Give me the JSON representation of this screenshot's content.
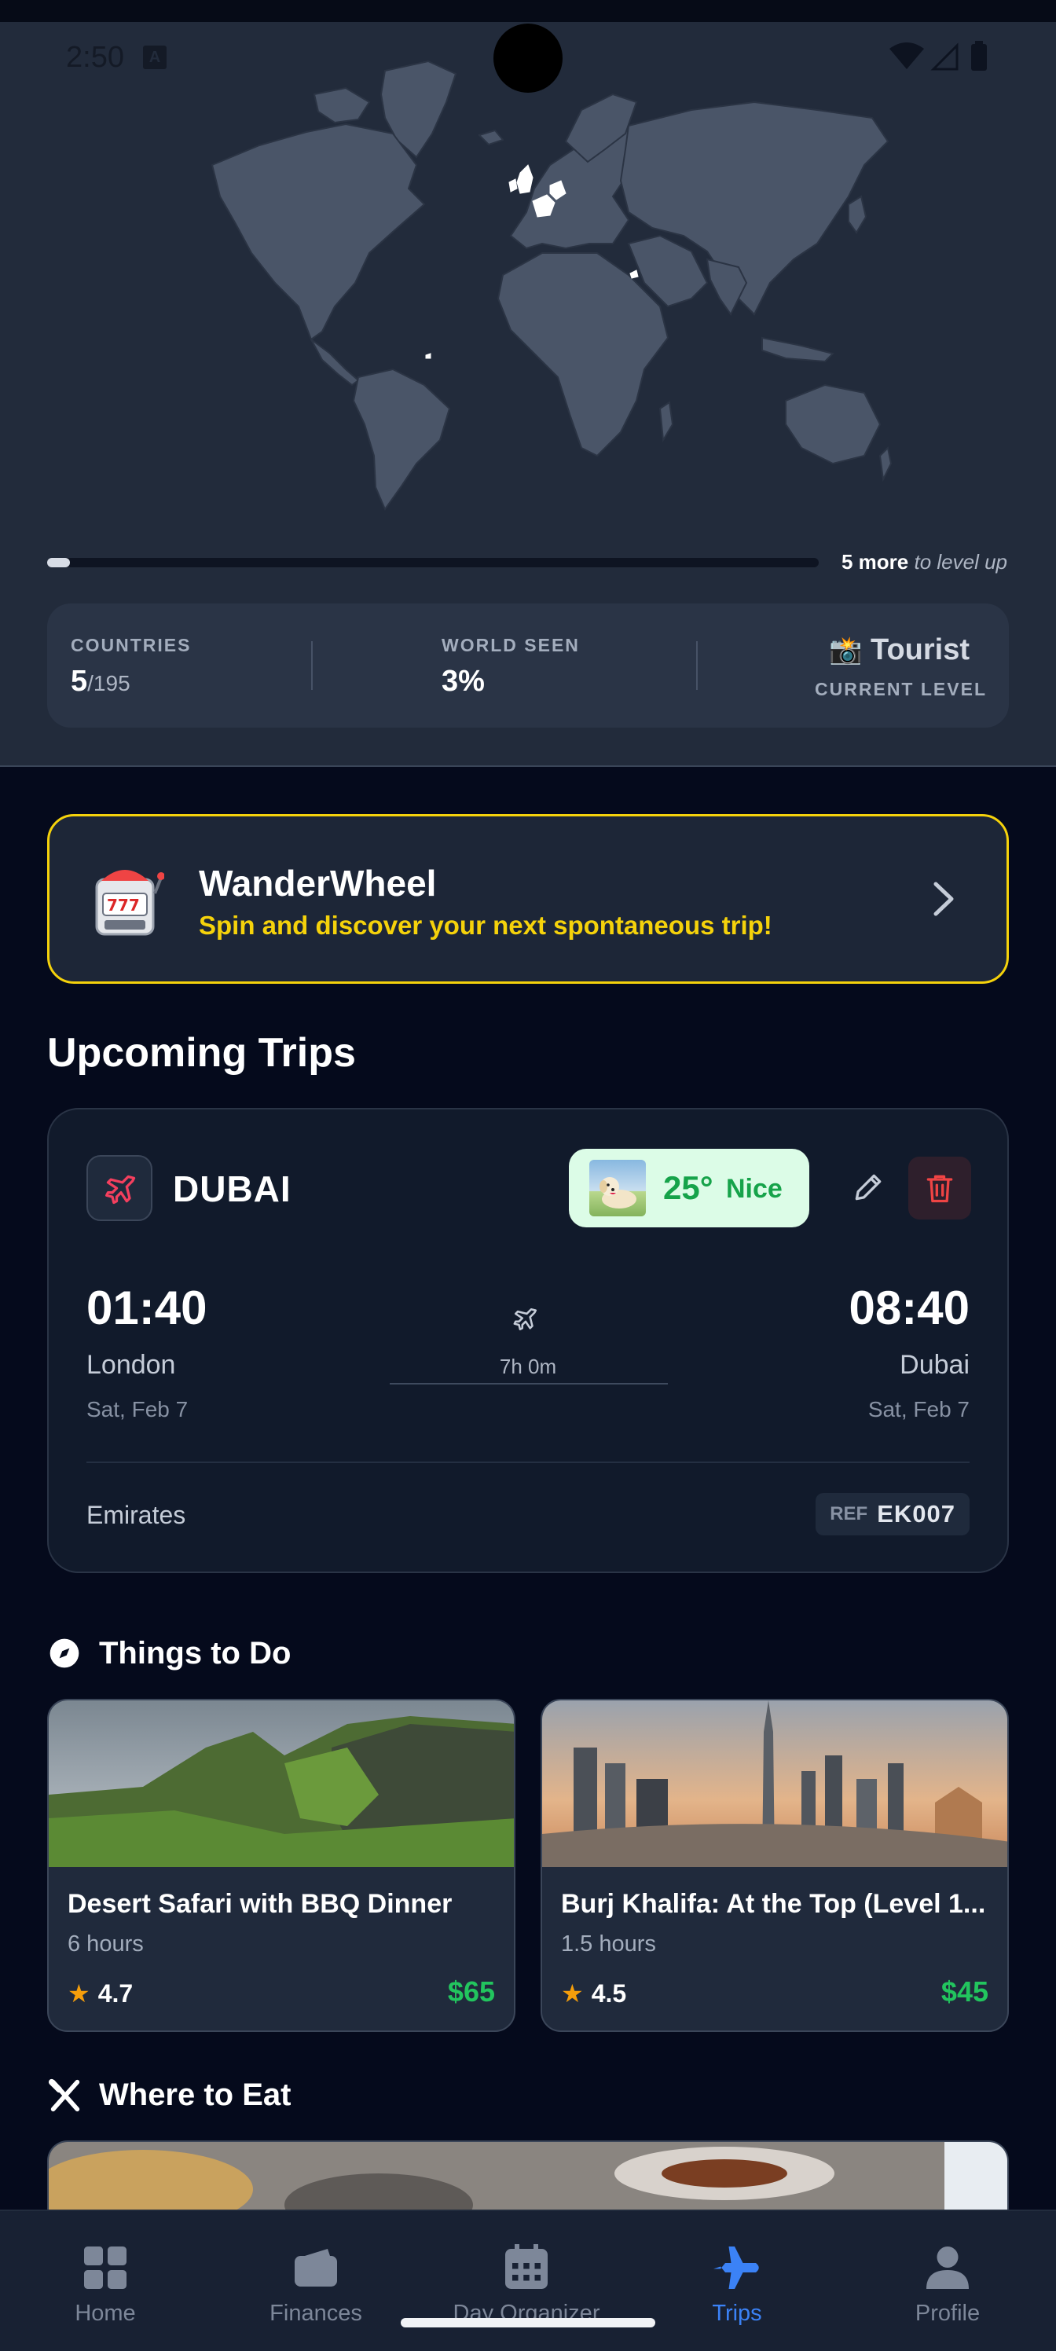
{
  "status_bar": {
    "time": "2:50",
    "a_badge": "A"
  },
  "map": {
    "progress": {
      "fraction": 0.03,
      "more_count": "5 more",
      "suffix": "to level up"
    },
    "stats": {
      "countries_label": "COUNTRIES",
      "countries_value": "5",
      "countries_total": "/195",
      "world_label": "WORLD SEEN",
      "world_value": "3%",
      "level_emoji": "📸",
      "level_name": "Tourist",
      "level_label": "CURRENT LEVEL"
    }
  },
  "wanderwheel": {
    "emoji": "🎰",
    "title": "WanderWheel",
    "subtitle": "Spin and discover your next spontaneous trip!"
  },
  "upcoming_title": "Upcoming Trips",
  "trip": {
    "destination": "DUBAI",
    "weather": {
      "temp": "25°",
      "word": "Nice"
    },
    "departure": {
      "time": "01:40",
      "city": "London",
      "date": "Sat, Feb 7"
    },
    "arrival": {
      "time": "08:40",
      "city": "Dubai",
      "date": "Sat, Feb 7"
    },
    "duration": "7h 0m",
    "airline": "Emirates",
    "ref_label": "REF",
    "ref_code": "EK007"
  },
  "things_to_do": {
    "title": "Things to Do",
    "items": [
      {
        "name": "Desert Safari with BBQ Dinner",
        "duration": "6 hours",
        "rating": "4.7",
        "price": "$65"
      },
      {
        "name": "Burj Khalifa: At the Top (Level 1...",
        "duration": "1.5 hours",
        "rating": "4.5",
        "price": "$45"
      }
    ]
  },
  "where_to_eat": {
    "title": "Where to Eat"
  },
  "nav": {
    "items": [
      {
        "label": "Home",
        "icon": "grid-icon"
      },
      {
        "label": "Finances",
        "icon": "wallet-icon"
      },
      {
        "label": "Day Organizer",
        "icon": "calendar-icon"
      },
      {
        "label": "Trips",
        "icon": "airplane-icon",
        "active": true
      },
      {
        "label": "Profile",
        "icon": "person-icon"
      }
    ]
  },
  "colors": {
    "accent_yellow": "#f5d20b",
    "active_blue": "#3b82f6",
    "price_green": "#22c55e",
    "delete_red": "#ef4444"
  }
}
